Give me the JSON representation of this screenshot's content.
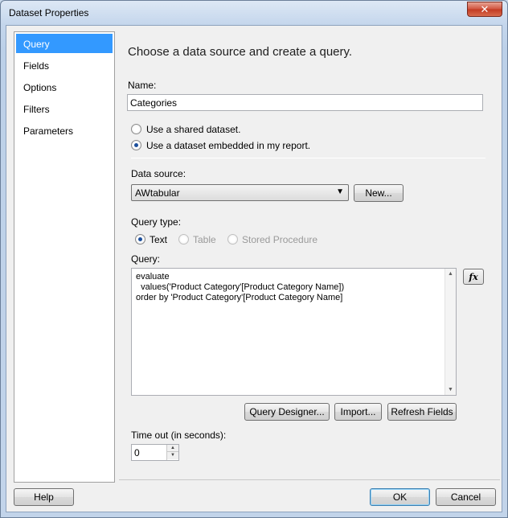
{
  "window": {
    "title": "Dataset Properties",
    "close_glyph": "✕"
  },
  "nav": {
    "items": [
      {
        "label": "Query",
        "selected": true
      },
      {
        "label": "Fields",
        "selected": false
      },
      {
        "label": "Options",
        "selected": false
      },
      {
        "label": "Filters",
        "selected": false
      },
      {
        "label": "Parameters",
        "selected": false
      }
    ]
  },
  "query_page": {
    "heading": "Choose a data source and create a query.",
    "name_label": "Name:",
    "name_value": "Categories",
    "radio_shared": "Use a shared dataset.",
    "radio_embedded": "Use a dataset embedded in my report.",
    "data_source_label": "Data source:",
    "data_source_value": "AWtabular",
    "new_button": "New...",
    "query_type_label": "Query type:",
    "query_type_text": "Text",
    "query_type_table": "Table",
    "query_type_stored": "Stored Procedure",
    "query_label": "Query:",
    "query_lines": [
      "evaluate",
      "  values('Product Category'[Product Category Name])",
      "order by 'Product Category'[Product Category Name]"
    ],
    "fx_button": "fx",
    "query_designer_button": "Query Designer...",
    "import_button": "Import...",
    "refresh_fields_button": "Refresh Fields",
    "timeout_label": "Time out (in seconds):",
    "timeout_value": "0"
  },
  "footer": {
    "help_button": "Help",
    "ok_button": "OK",
    "cancel_button": "Cancel"
  },
  "icons": {
    "dropdown_arrow": "▼",
    "scroll_up": "▲",
    "scroll_down": "▼",
    "spin_up": "▲",
    "spin_down": "▼"
  }
}
